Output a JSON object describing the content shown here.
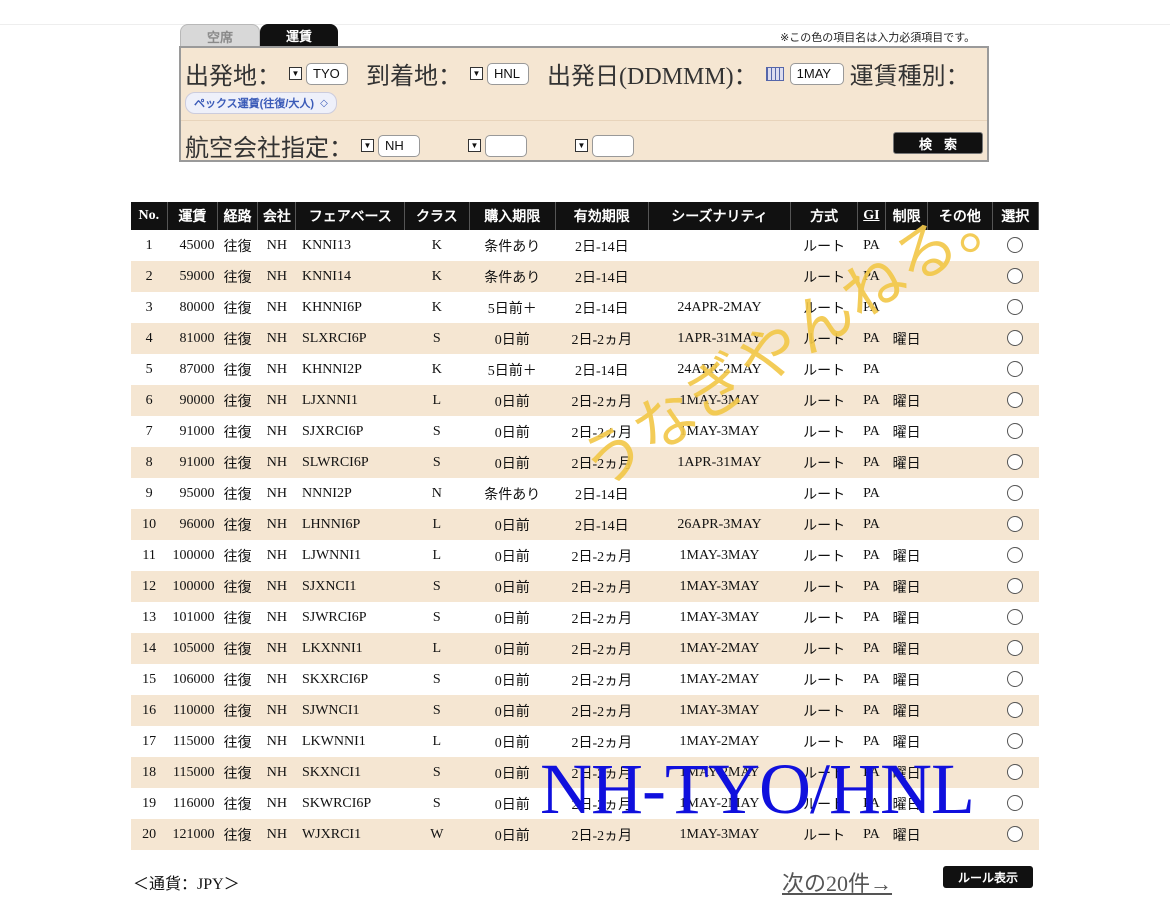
{
  "tabs": [
    {
      "label": "空席",
      "active": false
    },
    {
      "label": "運賃",
      "active": true
    }
  ],
  "note": "※この色の項目名は入力必須項目です。",
  "search": {
    "origin_label": "出発地：",
    "origin_value": "TYO",
    "dest_label": "到着地：",
    "dest_value": "HNL",
    "date_label": "出発日(DDMMM)：",
    "date_value": "1MAY",
    "fare_type_label": "運賃種別：",
    "fare_type_value": "ペックス運賃(往復/大人)",
    "airline_label": "航空会社指定：",
    "airline1_value": "NH",
    "airline2_value": "",
    "airline3_value": "",
    "search_button": "検索"
  },
  "table": {
    "headers": [
      "No.",
      "運賃",
      "経路",
      "会社",
      "フェアベース",
      "クラス",
      "購入期限",
      "有効期限",
      "シーズナリティ",
      "方式",
      "GI",
      "制限",
      "その他",
      "選択"
    ],
    "rows": [
      [
        "1",
        "45000",
        "往復",
        "NH",
        "KNNI13",
        "K",
        "条件あり",
        "2日-14日",
        "",
        "ルート",
        "PA",
        "",
        ""
      ],
      [
        "2",
        "59000",
        "往復",
        "NH",
        "KNNI14",
        "K",
        "条件あり",
        "2日-14日",
        "",
        "ルート",
        "PA",
        "",
        ""
      ],
      [
        "3",
        "80000",
        "往復",
        "NH",
        "KHNNI6P",
        "K",
        "5日前＋",
        "2日-14日",
        "24APR-2MAY",
        "ルート",
        "PA",
        "",
        ""
      ],
      [
        "4",
        "81000",
        "往復",
        "NH",
        "SLXRCI6P",
        "S",
        "0日前",
        "2日-2ヵ月",
        "1APR-31MAY",
        "ルート",
        "PA",
        "曜日",
        ""
      ],
      [
        "5",
        "87000",
        "往復",
        "NH",
        "KHNNI2P",
        "K",
        "5日前＋",
        "2日-14日",
        "24APR-2MAY",
        "ルート",
        "PA",
        "",
        ""
      ],
      [
        "6",
        "90000",
        "往復",
        "NH",
        "LJXNNI1",
        "L",
        "0日前",
        "2日-2ヵ月",
        "1MAY-3MAY",
        "ルート",
        "PA",
        "曜日",
        ""
      ],
      [
        "7",
        "91000",
        "往復",
        "NH",
        "SJXRCI6P",
        "S",
        "0日前",
        "2日-2ヵ月",
        "1MAY-3MAY",
        "ルート",
        "PA",
        "曜日",
        ""
      ],
      [
        "8",
        "91000",
        "往復",
        "NH",
        "SLWRCI6P",
        "S",
        "0日前",
        "2日-2ヵ月",
        "1APR-31MAY",
        "ルート",
        "PA",
        "曜日",
        ""
      ],
      [
        "9",
        "95000",
        "往復",
        "NH",
        "NNNI2P",
        "N",
        "条件あり",
        "2日-14日",
        "",
        "ルート",
        "PA",
        "",
        ""
      ],
      [
        "10",
        "96000",
        "往復",
        "NH",
        "LHNNI6P",
        "L",
        "0日前",
        "2日-14日",
        "26APR-3MAY",
        "ルート",
        "PA",
        "",
        ""
      ],
      [
        "11",
        "100000",
        "往復",
        "NH",
        "LJWNNI1",
        "L",
        "0日前",
        "2日-2ヵ月",
        "1MAY-3MAY",
        "ルート",
        "PA",
        "曜日",
        ""
      ],
      [
        "12",
        "100000",
        "往復",
        "NH",
        "SJXNCI1",
        "S",
        "0日前",
        "2日-2ヵ月",
        "1MAY-3MAY",
        "ルート",
        "PA",
        "曜日",
        ""
      ],
      [
        "13",
        "101000",
        "往復",
        "NH",
        "SJWRCI6P",
        "S",
        "0日前",
        "2日-2ヵ月",
        "1MAY-3MAY",
        "ルート",
        "PA",
        "曜日",
        ""
      ],
      [
        "14",
        "105000",
        "往復",
        "NH",
        "LKXNNI1",
        "L",
        "0日前",
        "2日-2ヵ月",
        "1MAY-2MAY",
        "ルート",
        "PA",
        "曜日",
        ""
      ],
      [
        "15",
        "106000",
        "往復",
        "NH",
        "SKXRCI6P",
        "S",
        "0日前",
        "2日-2ヵ月",
        "1MAY-2MAY",
        "ルート",
        "PA",
        "曜日",
        ""
      ],
      [
        "16",
        "110000",
        "往復",
        "NH",
        "SJWNCI1",
        "S",
        "0日前",
        "2日-2ヵ月",
        "1MAY-3MAY",
        "ルート",
        "PA",
        "曜日",
        ""
      ],
      [
        "17",
        "115000",
        "往復",
        "NH",
        "LKWNNI1",
        "L",
        "0日前",
        "2日-2ヵ月",
        "1MAY-2MAY",
        "ルート",
        "PA",
        "曜日",
        ""
      ],
      [
        "18",
        "115000",
        "往復",
        "NH",
        "SKXNCI1",
        "S",
        "0日前",
        "2日-2ヵ月",
        "1MAY-2MAY",
        "ルート",
        "PA",
        "曜日",
        ""
      ],
      [
        "19",
        "116000",
        "往復",
        "NH",
        "SKWRCI6P",
        "S",
        "0日前",
        "2日-2ヵ月",
        "1MAY-2MAY",
        "ルート",
        "PA",
        "曜日",
        ""
      ],
      [
        "20",
        "121000",
        "往復",
        "NH",
        "WJXRCI1",
        "W",
        "0日前",
        "2日-2ヵ月",
        "1MAY-3MAY",
        "ルート",
        "PA",
        "曜日",
        ""
      ]
    ]
  },
  "footer": {
    "currency": "＜通貨：JPY＞",
    "next_link": "次の20件→",
    "rule_button": "ルール表示"
  },
  "overlay": {
    "big_text": "NH-TYO/HNL",
    "script_text": "うなぎやんねる。"
  }
}
